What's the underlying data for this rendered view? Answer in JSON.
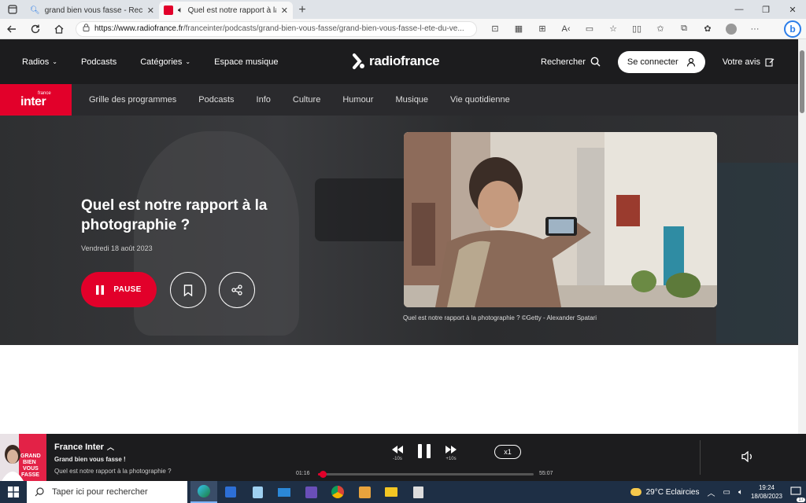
{
  "browser": {
    "tabs": [
      {
        "title": "grand bien vous fasse - Recherche",
        "active": false
      },
      {
        "title": "Quel est notre rapport à la photographie ?",
        "active": true
      }
    ],
    "url_host": "https://www.radiofrance.fr",
    "url_path": "/franceinter/podcasts/grand-bien-vous-fasse/grand-bien-vous-fasse-l-ete-du-ve..."
  },
  "header": {
    "nav": [
      "Radios",
      "Podcasts",
      "Catégories",
      "Espace musique"
    ],
    "logo": "radiofrance",
    "search": "Rechercher",
    "connect": "Se connecter",
    "feedback": "Votre avis"
  },
  "station_nav": {
    "logo_small": "france",
    "logo_big": "inter",
    "items": [
      "Grille des programmes",
      "Podcasts",
      "Info",
      "Culture",
      "Humour",
      "Musique",
      "Vie quotidienne"
    ]
  },
  "hero": {
    "title": "Quel est notre rapport à la photographie ?",
    "date": "Vendredi 18 août 2023",
    "pause_label": "PAUSE",
    "caption": "Quel est notre rapport à la photographie ? ©Getty - Alexander Spatari"
  },
  "player": {
    "art_lines": [
      "GRAND",
      "BIEN",
      "VOUS",
      "FASSE"
    ],
    "station": "France Inter",
    "show": "Grand bien vous fasse !",
    "episode": "Quel est notre rapport à la photographie ?",
    "back_label": "-10s",
    "fwd_label": "+10s",
    "speed": "x1",
    "elapsed": "01:16",
    "duration": "55:07",
    "progress": 0.023
  },
  "taskbar": {
    "search_placeholder": "Taper ici pour rechercher",
    "weather": "29°C  Eclaircies",
    "time": "19:24",
    "date": "18/08/2023",
    "notif_count": "17"
  },
  "colors": {
    "accent": "#e2002a",
    "dark": "#1c1c1e"
  }
}
